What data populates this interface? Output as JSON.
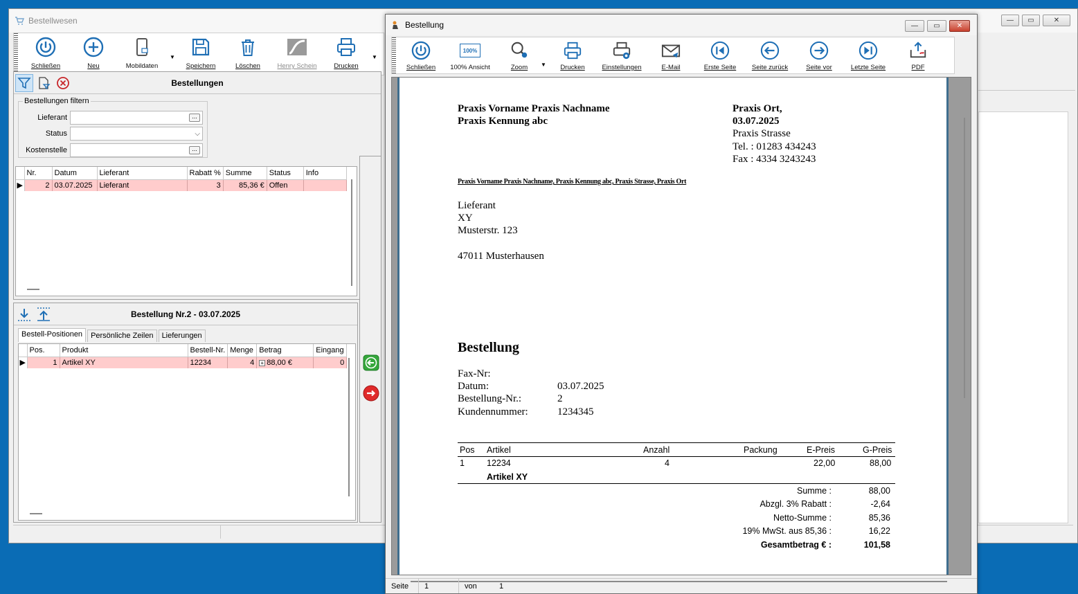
{
  "main_window": {
    "title": "Bestellwesen",
    "toolbar": [
      {
        "label": "Schließen",
        "icon": "power-icon"
      },
      {
        "label": "Neu",
        "icon": "plus-circle-icon"
      },
      {
        "label": "Mobildaten",
        "icon": "mobile-device-icon"
      },
      {
        "label": "Speichern",
        "icon": "save-icon"
      },
      {
        "label": "Löschen",
        "icon": "trash-icon"
      },
      {
        "label": "Henry Schein",
        "icon": "henry-schein-logo-icon"
      },
      {
        "label": "Drucken",
        "icon": "printer-icon"
      }
    ],
    "orders_panel": {
      "title": "Bestellungen",
      "filter_legend": "Bestellungen filtern",
      "filter_labels": {
        "lieferant": "Lieferant",
        "status": "Status",
        "kostenstelle": "Kostenstelle"
      },
      "columns": [
        "Nr.",
        "Datum",
        "Lieferant",
        "Rabatt %",
        "Summe",
        "Status",
        "Info"
      ],
      "rows": [
        {
          "nr": "2",
          "datum": "03.07.2025",
          "lieferant": "Lieferant",
          "rabatt": "3",
          "summe": "85,36 €",
          "status": "Offen",
          "info": ""
        }
      ]
    },
    "detail_panel": {
      "title": "Bestellung Nr.2 - 03.07.2025",
      "tabs": [
        "Bestell-Positionen",
        "Persönliche Zeilen",
        "Lieferungen"
      ],
      "columns": [
        "Pos.",
        "Produkt",
        "Bestell-Nr.",
        "Menge",
        "Betrag",
        "Eingang"
      ],
      "rows": [
        {
          "pos": "1",
          "produkt": "Artikel XY",
          "bestellnr": "12234",
          "menge": "4",
          "betrag": "88,00 €",
          "eingang": "0"
        }
      ]
    }
  },
  "report_window": {
    "title": "Bestellung",
    "toolbar": [
      {
        "label": "Schließen",
        "icon": "power-icon"
      },
      {
        "label": "100% Ansicht",
        "icon": "zoom-100-icon",
        "icon_text": "100%"
      },
      {
        "label": "Zoom",
        "icon": "zoom-icon"
      },
      {
        "label": "Drucken",
        "icon": "printer-icon"
      },
      {
        "label": "Einstellungen",
        "icon": "printer-settings-icon"
      },
      {
        "label": "E-Mail",
        "icon": "email-icon"
      },
      {
        "label": "Erste Seite",
        "icon": "first-page-icon"
      },
      {
        "label": "Seite zurück",
        "icon": "arrow-left-icon"
      },
      {
        "label": "Seite vor",
        "icon": "arrow-right-icon"
      },
      {
        "label": "Letzte Seite",
        "icon": "last-page-icon"
      },
      {
        "label": "PDF",
        "icon": "pdf-export-icon"
      }
    ],
    "document": {
      "sender_name": "Praxis Vorname Praxis Nachname",
      "sender_id": "Praxis Kennung abc",
      "place_date_city": "Praxis Ort,",
      "place_date_date": "03.07.2025",
      "street": "Praxis Strasse",
      "tel": "Tel. : 01283 434243",
      "fax": "Fax : 4334 3243243",
      "return_address": "Praxis Vorname Praxis Nachname, Praxis Kennung abc, Praxis Strasse, Praxis Ort",
      "recipient": [
        "Lieferant",
        "XY",
        "Musterstr. 123",
        "47011 Musterhausen"
      ],
      "heading": "Bestellung",
      "meta": [
        {
          "label": "Fax-Nr:",
          "value": ""
        },
        {
          "label": "Datum:",
          "value": "03.07.2025"
        },
        {
          "label": "Bestellung-Nr.:",
          "value": "2"
        },
        {
          "label": "Kundennummer:",
          "value": "1234345"
        }
      ],
      "table_headers": {
        "pos": "Pos",
        "artikel": "Artikel",
        "anzahl": "Anzahl",
        "packung": "Packung",
        "epreis": "E-Preis",
        "gpreis": "G-Preis"
      },
      "item": {
        "pos": "1",
        "artikel_nr": "12234",
        "anzahl": "4",
        "epreis": "22,00",
        "gpreis": "88,00",
        "name": "Artikel XY"
      },
      "totals": [
        {
          "label": "Summe :",
          "value": "88,00"
        },
        {
          "label": "Abzgl. 3% Rabatt :",
          "value": "-2,64"
        },
        {
          "label": "Netto-Summe :",
          "value": "85,36"
        },
        {
          "label": "19% MwSt. aus 85,36 :",
          "value": "16,22"
        },
        {
          "label": "Gesamtbetrag € :",
          "value": "101,58"
        }
      ]
    },
    "status": {
      "page_label": "Seite",
      "page": "1",
      "of_label": "von",
      "total": "1"
    }
  }
}
